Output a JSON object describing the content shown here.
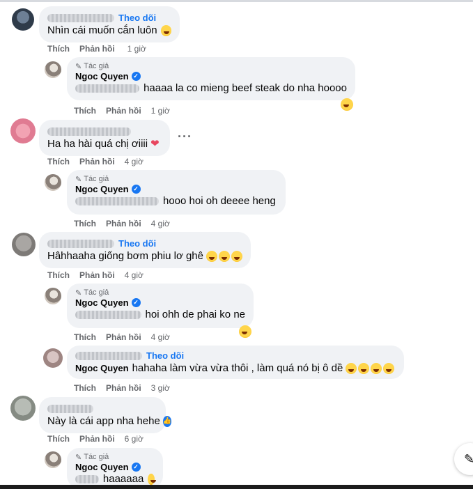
{
  "actions": {
    "like": "Thích",
    "reply": "Phản hồi"
  },
  "follow_label": "Theo dõi",
  "author_label": "Tác giả",
  "author_name": "Ngoc Quyen",
  "comments": [
    {
      "text": "Nhìn cái muốn cắn luôn",
      "time": "1 giờ"
    },
    {
      "text": "haaaa la co mieng beef steak do nha hoooo",
      "time": "1 giờ"
    },
    {
      "text": "Ha ha hài quá chị ơiiii",
      "time": "4 giờ"
    },
    {
      "text": "hooo hoi oh deeee heng",
      "time": "4 giờ"
    },
    {
      "text": "Hâhhaaha giống bơm phiu lơ ghê",
      "time": "4 giờ"
    },
    {
      "text": "hoi ohh de phai ko ne",
      "time": "4 giờ"
    },
    {
      "text": "hahaha làm vừa vừa thôi , làm quá nó bị ô dề",
      "time": "3 giờ"
    },
    {
      "text": "Này là cái app nha hehe",
      "time": "6 giờ"
    },
    {
      "text": "haaaaaa",
      "time": ""
    }
  ],
  "icons": {
    "more": "more-options-icon",
    "verified": "verified-badge-icon",
    "emoji": "laughing-emoji-icon",
    "heart": "broken-heart-emoji-icon",
    "like": "thumbs-up-icon",
    "pen": "pen-icon",
    "corner": "compose-icon"
  },
  "colors": {
    "accent": "#1877f2",
    "bubble": "#f0f2f5",
    "meta": "#65676b"
  }
}
